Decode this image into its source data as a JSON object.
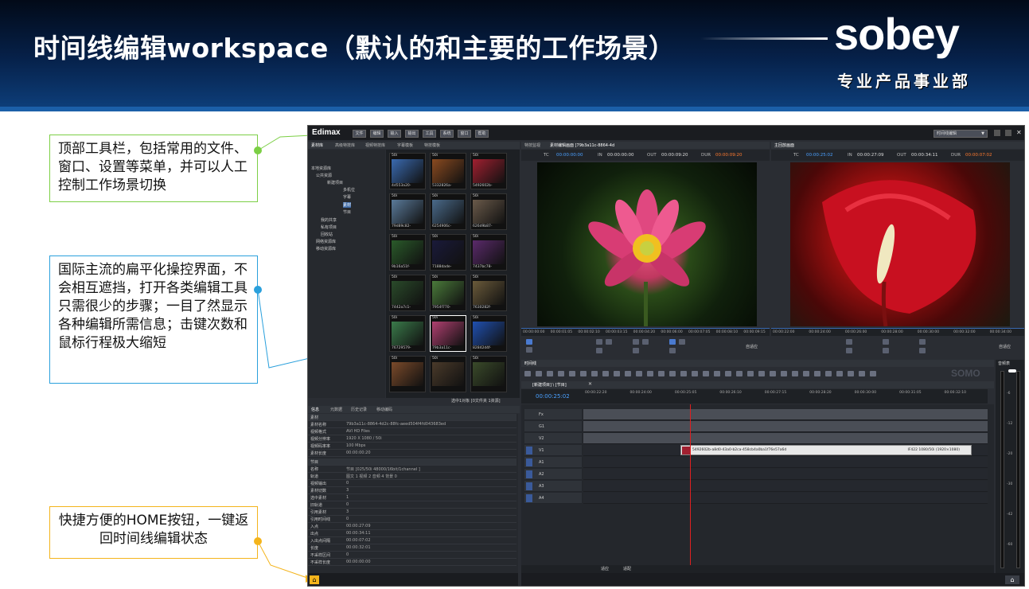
{
  "slide": {
    "title": "时间线编辑workspace（默认的和主要的工作场景）",
    "logo_text": "sobey",
    "logo_subtitle": "专业产品事业部",
    "colors": {
      "header_dark": "#020a18",
      "header_light": "#0d3d78",
      "green": "#7ccf45",
      "blue": "#2aa0dc",
      "yellow": "#f4b41c"
    }
  },
  "callouts": [
    {
      "text": "顶部工具栏，包括常用的文件、窗口、设置等菜单，并可以人工控制工作场景切换"
    },
    {
      "text": "国际主流的扁平化操控界面，不会相互遮挡，打开各类编辑工具只需很少的步骤；一目了然显示各种编辑所需信息；击键次数和鼠标行程极大缩短"
    },
    {
      "text": "快捷方便的HOME按钮，一键返回时间线编辑状态"
    }
  ],
  "app": {
    "name": "Edimax",
    "menu": [
      "文件",
      "编辑",
      "输入",
      "输出",
      "工具",
      "系统",
      "窗口",
      "帮助"
    ],
    "workspace_select": "时间线编辑",
    "left_tabs": [
      "素材库",
      "高级特技库",
      "视频特技库",
      "字幕模板",
      "特技模板"
    ],
    "tree": [
      "本地资源库",
      "公共资源",
      "新建项目",
      "多机位",
      "字幕",
      "素材",
      "节目",
      "我的共享",
      "私有项目",
      "回收站",
      "网络资源库",
      "移动资源库"
    ],
    "thumbs": [
      {
        "dur": "50i",
        "name": "4d553a20-"
      },
      {
        "dur": "50i",
        "name": "5332826a-"
      },
      {
        "dur": "50i",
        "name": "5492602b-"
      },
      {
        "dur": "50i",
        "name": "79d89c82-"
      },
      {
        "dur": "50i",
        "name": "6254906c-"
      },
      {
        "dur": "50i",
        "name": "626d9b87-"
      },
      {
        "dur": "50i",
        "name": "9b16a51f-"
      },
      {
        "dur": "50i",
        "name": "7188dade-"
      },
      {
        "dur": "50i",
        "name": "7437bc78-"
      },
      {
        "dur": "50i",
        "name": "7442a7c1-"
      },
      {
        "dur": "50i",
        "name": "7954f770-"
      },
      {
        "dur": "50i",
        "name": "7630282f-"
      },
      {
        "dur": "50i",
        "name": "76729579-"
      },
      {
        "dur": "50i",
        "name": "79b3a11c-"
      },
      {
        "dur": "50i",
        "name": "82842d4f-"
      },
      {
        "dur": "50i",
        "name": ""
      },
      {
        "dur": "50i",
        "name": ""
      },
      {
        "dur": "50i",
        "name": ""
      }
    ],
    "thumb_colors": [
      "#3a6ab0",
      "#8a4a20",
      "#a02030",
      "#5a7a9a",
      "#4a6a8a",
      "#6a5a4a",
      "#2a5a2a",
      "#1a1a3a",
      "#5a2a6a",
      "#2a4a2a",
      "#4a7a3a",
      "#6a5a3a",
      "#3a7a4a",
      "#b04070",
      "#2050b0",
      "#7a4a2a",
      "#4a3a2a",
      "#3a4a2a"
    ],
    "browser_status": "选中1对象 [0文件夹 1资源]",
    "info_tabs": [
      "信息",
      "元数据",
      "历史记录",
      "移动编码"
    ],
    "section_material": "素材",
    "material_props": [
      {
        "k": "素材名称",
        "v": "79b3a11c-8864-4d2c-88fc-aeed504f4fd043683ed"
      },
      {
        "k": "视频格式",
        "v": "AVI HD Files"
      },
      {
        "k": "视频分辨率",
        "v": "1920 X 1080 / 50i"
      },
      {
        "k": "视频码率率",
        "v": "100 Mbps"
      },
      {
        "k": "素材长度",
        "v": "00:00:00:20"
      }
    ],
    "section_program": "节目",
    "program_props": [
      {
        "k": "名称",
        "v": "节目 [025/50i 48000/16bit/1channel ]"
      },
      {
        "k": "轨道",
        "v": "图文 1 视频 2 音频 4 背景 0"
      },
      {
        "k": "视频输出",
        "v": "0"
      },
      {
        "k": "素材切数",
        "v": "3"
      },
      {
        "k": "选中素材",
        "v": "1"
      },
      {
        "k": "旧轨道",
        "v": "0"
      },
      {
        "k": "引用素材",
        "v": "3"
      },
      {
        "k": "引用时间线",
        "v": "0"
      },
      {
        "k": "入点",
        "v": "00:00:27:09"
      },
      {
        "k": "出点",
        "v": "00:00:34:11"
      },
      {
        "k": "入出点间隔",
        "v": "00:00:07:02"
      },
      {
        "k": "长度",
        "v": "00:00:32:01"
      },
      {
        "k": "不采样区间",
        "v": "0"
      },
      {
        "k": "不采样长度",
        "v": "00:00:00:00"
      }
    ],
    "src_tabs": [
      "特技监视",
      "素材编辑画面 [79b3a11c-8864-4d"
    ],
    "src_tc": {
      "tc": "00:00:00:00",
      "in": "00:00:00:00",
      "out": "00:00:09:20",
      "dur": "00:00:09:20"
    },
    "rec_tabs": [
      "主回放画面"
    ],
    "rec_tc": {
      "tc": "00:00:25:02",
      "in": "00:00:27:09",
      "out": "00:00:34:11",
      "dur": "00:00:07:02"
    },
    "ruler_src": [
      "00:00:00:00",
      "00:00:01:05",
      "00:00:02:10",
      "00:00:03:15",
      "00:00:04:20",
      "00:00:06:00",
      "00:00:07:05",
      "00:00:08:10",
      "00:00:09:15"
    ],
    "ruler_rec": [
      "00:00:22:00",
      "00:00:24:00",
      "00:00:26:00",
      "00:00:28:00",
      "00:00:30:00",
      "00:00:32:00",
      "00:00:34:00"
    ],
    "auto_label": "自适应",
    "timeline_title": "时间线",
    "timeline_tab": "[新建项目] \\ [节目]",
    "timeline_tc": "00:00:25:02",
    "timeline_ruler": [
      "00:00:22:20",
      "00:00:24:00",
      "00:00:25:05",
      "00:00:26:10",
      "00:00:27:15",
      "00:00:28:20",
      "00:00:30:00",
      "00:00:31:05",
      "00:00:32:10"
    ],
    "tracks": [
      "Fx",
      "G1",
      "V2",
      "V1",
      "A1",
      "A2",
      "A3",
      "A4"
    ],
    "clip_name": "5492602b-a8d0-43a0-b2ca-458cb4a0ba1f76e57a6d",
    "clip_info": "IF422 1080/50i (1920×1080)",
    "watermark": "SOMO",
    "meter_label": "音频表",
    "meter_scale": [
      "-6",
      "-12",
      "-20",
      "-30",
      "-42",
      "-60"
    ],
    "tl_bottom": [
      "适应",
      "适配"
    ]
  }
}
